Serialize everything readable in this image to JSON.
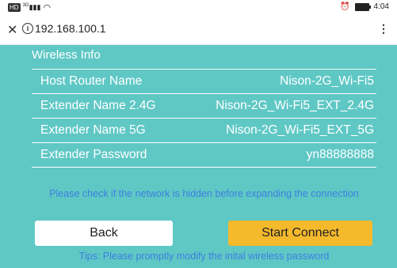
{
  "status_bar": {
    "hd": "HD",
    "signal": "3G",
    "time": "4:04"
  },
  "browser": {
    "url": "192.168.100.1"
  },
  "section_title": "Wireless Info",
  "rows": [
    {
      "label": "Host Router Name",
      "value": "Nison-2G_Wi-Fi5"
    },
    {
      "label": "Extender Name 2.4G",
      "value": "Nison-2G_Wi-Fi5_EXT_2.4G"
    },
    {
      "label": "Extender Name 5G",
      "value": "Nison-2G_Wi-Fi5_EXT_5G"
    },
    {
      "label": "Extender Password",
      "value": "yn88888888"
    }
  ],
  "notice": "Please check if the network is hidden before expanding the connection",
  "buttons": {
    "back": "Back",
    "start": "Start Connect"
  },
  "tips": "Tips: Please promptly modify the inital wireless password",
  "colors": {
    "background": "#5fc8c5",
    "accent_button": "#f5b92c",
    "notice_text": "#3d7fe0"
  }
}
